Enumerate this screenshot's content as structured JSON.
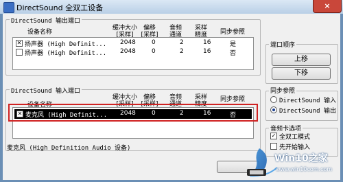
{
  "title": "DirectSound 全双工设备",
  "close_glyph": "×",
  "output_group": {
    "label": "DirectSound 输出端口",
    "columns": [
      "设备名称",
      "缓冲大小\n[采样]",
      "偏移\n[采样]",
      "音频\n通道",
      "采样\n精度",
      "同步参照"
    ],
    "rows": [
      {
        "checked": true,
        "name": "扬声器 (High Definit...",
        "buffer": "2048",
        "offset": "0",
        "channels": "2",
        "precision": "16",
        "sync": "是"
      },
      {
        "checked": false,
        "name": "扬声器 (High Definit...",
        "buffer": "2048",
        "offset": "0",
        "channels": "2",
        "precision": "16",
        "sync": "否"
      }
    ]
  },
  "input_group": {
    "label": "DirectSound 输入端口",
    "columns": [
      "设备名称",
      "缓冲大小\n[采样]",
      "偏移\n[采样]",
      "音频\n通道",
      "采样\n精度",
      "同步参照"
    ],
    "rows": [
      {
        "checked": true,
        "name": "麦克风 (High Definit...",
        "buffer": "2048",
        "offset": "0",
        "channels": "2",
        "precision": "16",
        "sync": "否"
      }
    ],
    "status": "麦克风 (High Definition Audio 设备)"
  },
  "port_order": {
    "label": "端口顺序",
    "up": "上移",
    "down": "下移"
  },
  "sync_ref": {
    "label": "同步参照",
    "options": [
      "DirectSound 输入",
      "DirectSound 输出"
    ],
    "selected_index": 1
  },
  "audio_options": {
    "label": "音频卡选项",
    "options": [
      {
        "label": "全双工模式",
        "checked": true
      },
      {
        "label": "先开始输入",
        "checked": false
      }
    ]
  },
  "watermark": {
    "site": "Win10之家",
    "url": "www.win10com.com"
  }
}
